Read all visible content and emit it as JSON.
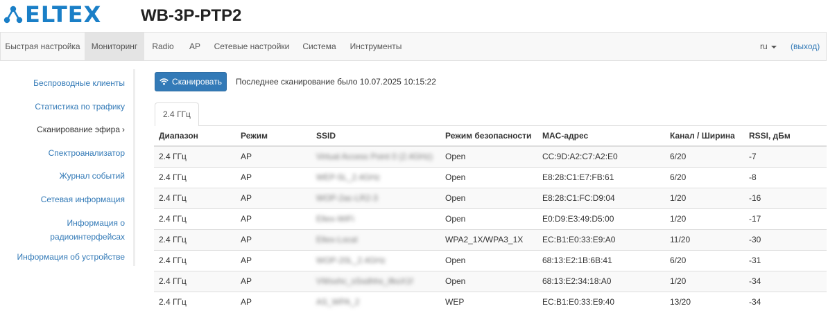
{
  "header": {
    "logo_text": "ELTEX",
    "device_title": "WB-3P-PTP2",
    "brand_color": "#1a7fc7"
  },
  "navbar": {
    "items": [
      {
        "label": "Быстрая настройка",
        "active": false
      },
      {
        "label": "Мониторинг",
        "active": true
      },
      {
        "label": "Radio",
        "active": false
      },
      {
        "label": "AP",
        "active": false
      },
      {
        "label": "Сетевые настройки",
        "active": false
      },
      {
        "label": "Система",
        "active": false
      },
      {
        "label": "Инструменты",
        "active": false
      }
    ],
    "language": "ru",
    "logout_label": "(выход)"
  },
  "sidebar": {
    "items": [
      {
        "label": "Беспроводные клиенты",
        "active": false
      },
      {
        "label": "Статистика по трафику",
        "active": false
      },
      {
        "label": "Сканирование эфира",
        "active": true,
        "chevron": "›"
      },
      {
        "label": "Спектроанализатор",
        "active": false
      },
      {
        "label": "Журнал событий",
        "active": false
      },
      {
        "label": "Сетевая информация",
        "active": false
      },
      {
        "label": "Информация о",
        "label2": "радиоинтерфейсах",
        "active": false
      },
      {
        "label": "Информация об устройстве",
        "active": false
      }
    ]
  },
  "scan": {
    "button_label": "Сканировать",
    "button_icon": "wifi-icon",
    "status_text": "Последнее сканирование было 10.07.2025 10:15:22"
  },
  "tabs": [
    {
      "label": "2.4 ГГц",
      "active": true
    }
  ],
  "table": {
    "columns": [
      "Диапазон",
      "Режим",
      "SSID",
      "Режим безопасности",
      "MAC-адрес",
      "Канал / Ширина",
      "RSSI, дБм"
    ],
    "rows": [
      [
        "2.4 ГГц",
        "AP",
        "Virtual Access Point 0 (2.4GHz)",
        "Open",
        "CC:9D:A2:C7:A2:E0",
        "6/20",
        "-7"
      ],
      [
        "2.4 ГГц",
        "AP",
        "WEP-5L_2.4GHz",
        "Open",
        "E8:28:C1:E7:FB:61",
        "6/20",
        "-8"
      ],
      [
        "2.4 ГГц",
        "AP",
        "WOP-2ac-LR2-3",
        "Open",
        "E8:28:C1:FC:D9:04",
        "1/20",
        "-16"
      ],
      [
        "2.4 ГГц",
        "AP",
        "Eltex-WiFi",
        "Open",
        "E0:D9:E3:49:D5:00",
        "1/20",
        "-17"
      ],
      [
        "2.4 ГГц",
        "AP",
        "Eltex-Local",
        "WPA2_1X/WPA3_1X",
        "EC:B1:E0:33:E9:A0",
        "11/20",
        "-30"
      ],
      [
        "2.4 ГГц",
        "AP",
        "WOP-20L_2.4GHz",
        "Open",
        "68:13:E2:1B:6B:41",
        "6/20",
        "-31"
      ],
      [
        "2.4 ГГц",
        "AP",
        "VWsxhc_sSsdhhs_ifksX1f",
        "Open",
        "68:13:E2:34:18:A0",
        "1/20",
        "-34"
      ],
      [
        "2.4 ГГц",
        "AP",
        "AS_WPA_2",
        "WEP",
        "EC:B1:E0:33:E9:40",
        "13/20",
        "-34"
      ]
    ]
  }
}
